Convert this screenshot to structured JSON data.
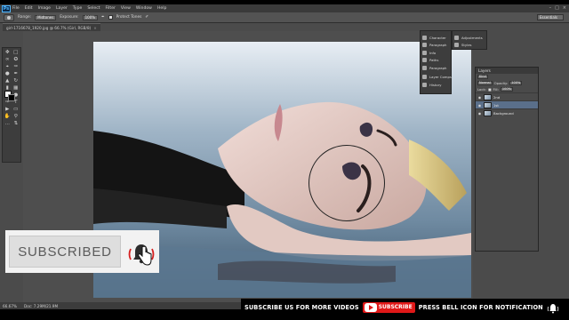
{
  "app": {
    "logo": "Ps"
  },
  "menu": [
    "File",
    "Edit",
    "Image",
    "Layer",
    "Type",
    "Select",
    "Filter",
    "View",
    "Window",
    "Help"
  ],
  "options": {
    "range_label": "Range:",
    "range_value": "Midtones",
    "exposure_label": "Exposure:",
    "exposure_value": "100%",
    "protect_label": "Protect Tones",
    "workspace": "Essentials"
  },
  "document": {
    "tab": "girl-1716678_1920.jpg @ 66.7% (Girl, RGB/8)"
  },
  "dock": {
    "items": [
      "Character",
      "Paragraph",
      "Info",
      "Paths",
      "Paragraph",
      "Layer Comps",
      "History"
    ],
    "items2": [
      "Adjustments",
      "Styles"
    ]
  },
  "layers_panel": {
    "title": "Layers",
    "kind": "Kind",
    "mode": "Normal",
    "opacity_label": "Opacity:",
    "opacity": "100%",
    "lock_label": "Lock:",
    "fill_label": "Fill:",
    "fill": "100%",
    "layers": [
      {
        "name": "2nd",
        "selected": false
      },
      {
        "name": "1st",
        "selected": true
      },
      {
        "name": "Background",
        "selected": false
      }
    ]
  },
  "status": {
    "zoom": "66.67%",
    "doc": "Doc: 7.29M/21.9M"
  },
  "banner": {
    "left_text": "SUBSCRIBE US FOR  MORE VIDEOS",
    "button": "SUBSCRIBE",
    "right_text": "PRESS BELL ICON FOR NOTIFICATION"
  },
  "overlay": {
    "subscribed": "SUBSCRIBED"
  },
  "colors": {
    "accent": "#e01818",
    "panel": "#4b4b4b"
  }
}
